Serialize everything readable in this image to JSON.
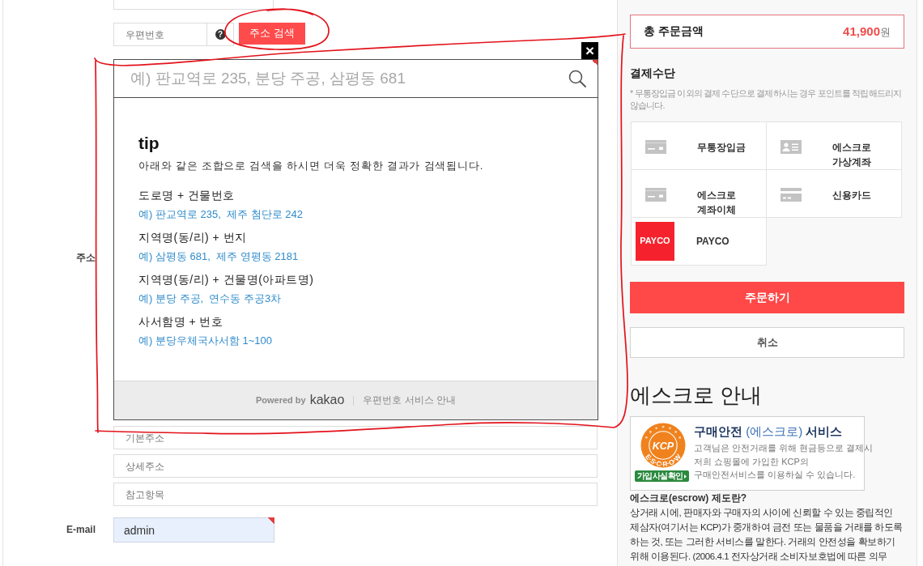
{
  "form": {
    "cut_off_field": {
      "kind": "text"
    },
    "address": {
      "label": "주소",
      "postcode_placeholder": "우편번호",
      "help_mark": "?",
      "search_button": "주소 검색",
      "search_button_hand_circled": true,
      "detail_fields": [
        {
          "placeholder": "기본주소"
        },
        {
          "placeholder": "상세주소"
        },
        {
          "placeholder": "참고항목"
        }
      ]
    },
    "email": {
      "label": "E-mail",
      "value": "admin",
      "required": true,
      "autofilled": true
    }
  },
  "postcode_popup": {
    "hand_outlined": true,
    "close": "×",
    "corner_marker": true,
    "search_placeholder": "예) 판교역로 235, 분당 주공, 삼평동 681",
    "tip_title": "tip",
    "tip_text": "아래와 같은 조합으로 검색을 하시면 더욱 정확한 결과가 검색됩니다.",
    "tips": [
      {
        "format": "도로명 + 건물번호",
        "example": "예) 판교역로 235,  제주 첨단로 242"
      },
      {
        "format": "지역명(동/리) + 번지",
        "example": "예) 삼평동 681,  제주 영평동 2181"
      },
      {
        "format": "지역명(동/리) + 건물명(아파트명)",
        "example": "예) 분당 주공,  연수동 주공3차"
      },
      {
        "format": "사서함명 + 번호",
        "example": "예) 분당우체국사서함 1~100"
      }
    ],
    "powered_by": "Powered by",
    "brand": "kakao",
    "guide_link": "우편번호 서비스 안내"
  },
  "sidebar": {
    "total": {
      "label": "총 주문금액",
      "amount": "41,900",
      "unit": "원"
    },
    "payment": {
      "title": "결제수단",
      "note": "* 무통장입금 이외의 결제 수단으로 결제하시는 경우 포인트를 적립해드리지 않습니다.",
      "methods": [
        {
          "kind": "bank",
          "label": "무통장입금"
        },
        {
          "kind": "account",
          "label": "에스크로 가상계좌"
        },
        {
          "kind": "transfer",
          "label": "에스크로 계좌이체"
        },
        {
          "kind": "card",
          "label": "신용카드"
        },
        {
          "kind": "logo",
          "logo_text": "PAYCO",
          "label": "PAYCO"
        }
      ]
    },
    "order_button": "주문하기",
    "cancel_button": "취소",
    "escrow": {
      "title": "에스크로 안내",
      "banner": {
        "seal_text": "KCP",
        "seal_ring_text": "E·S·C·R·O·W",
        "verify_badge": "가입사실확인",
        "heading": "**구매안전** (에스크로) **서비스**",
        "lines": [
          "고객님은 안전거래를 위해 현금등으로 결제시",
          "저희 쇼핑몰에 가입한 KCP의",
          "구매안전서비스를 이용하실 수 있습니다."
        ]
      },
      "definition_title": "에스크로(escrow) 제도란?",
      "definition_lines": [
        "상거래 시에, 판매자와 구매자의 사이에 신뢰할 수 있는 중립적인",
        "제삼자(여기서는 KCP)가 중개하여 금전 또는 물품을 거래를 하도록",
        "하는 것, 또는 그러한 서비스를 말한다. 거래의 안전성을 확보하기",
        "위해 이용된다. (2006.4.1 전자상거래 소비자보호법에 따른 의무"
      ]
    }
  }
}
